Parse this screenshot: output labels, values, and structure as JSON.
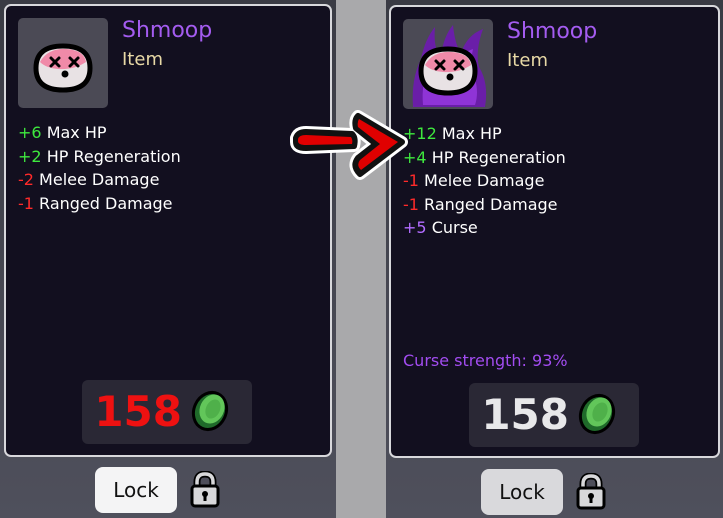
{
  "left_card": {
    "item_name": "Shmoop",
    "item_type": "Item",
    "stats": [
      {
        "value": "+6",
        "label": "Max HP",
        "kind": "pos"
      },
      {
        "value": "+2",
        "label": "HP Regeneration",
        "kind": "pos"
      },
      {
        "value": "-2",
        "label": "Melee Damage",
        "kind": "neg"
      },
      {
        "value": "-1",
        "label": "Ranged Damage",
        "kind": "neg"
      }
    ],
    "price": "158",
    "price_color": "#ee1111",
    "lock_label": "Lock"
  },
  "right_card": {
    "item_name": "Shmoop",
    "item_type": "Item",
    "stats": [
      {
        "value": "+12",
        "label": "Max HP",
        "kind": "pos"
      },
      {
        "value": "+4",
        "label": "HP Regeneration",
        "kind": "pos"
      },
      {
        "value": "-1",
        "label": "Melee Damage",
        "kind": "neg"
      },
      {
        "value": "-1",
        "label": "Ranged Damage",
        "kind": "neg"
      },
      {
        "value": "+5",
        "label": "Curse",
        "kind": "curse"
      }
    ],
    "curse_strength_label": "Curse strength:",
    "curse_strength_value": "93%",
    "price": "158",
    "price_color": "#e8e8ea",
    "lock_label": "Lock"
  },
  "colors": {
    "name": "#a45cf0",
    "type": "#e8d9a6",
    "positive": "#3ee83e",
    "negative": "#ff2a2a",
    "curse": "#b26cff",
    "arrow": "#e00000"
  },
  "icons": [
    "shmoop-item-icon",
    "cursed-shmoop-item-icon",
    "green-coin-icon",
    "padlock-icon",
    "right-arrow-icon"
  ]
}
